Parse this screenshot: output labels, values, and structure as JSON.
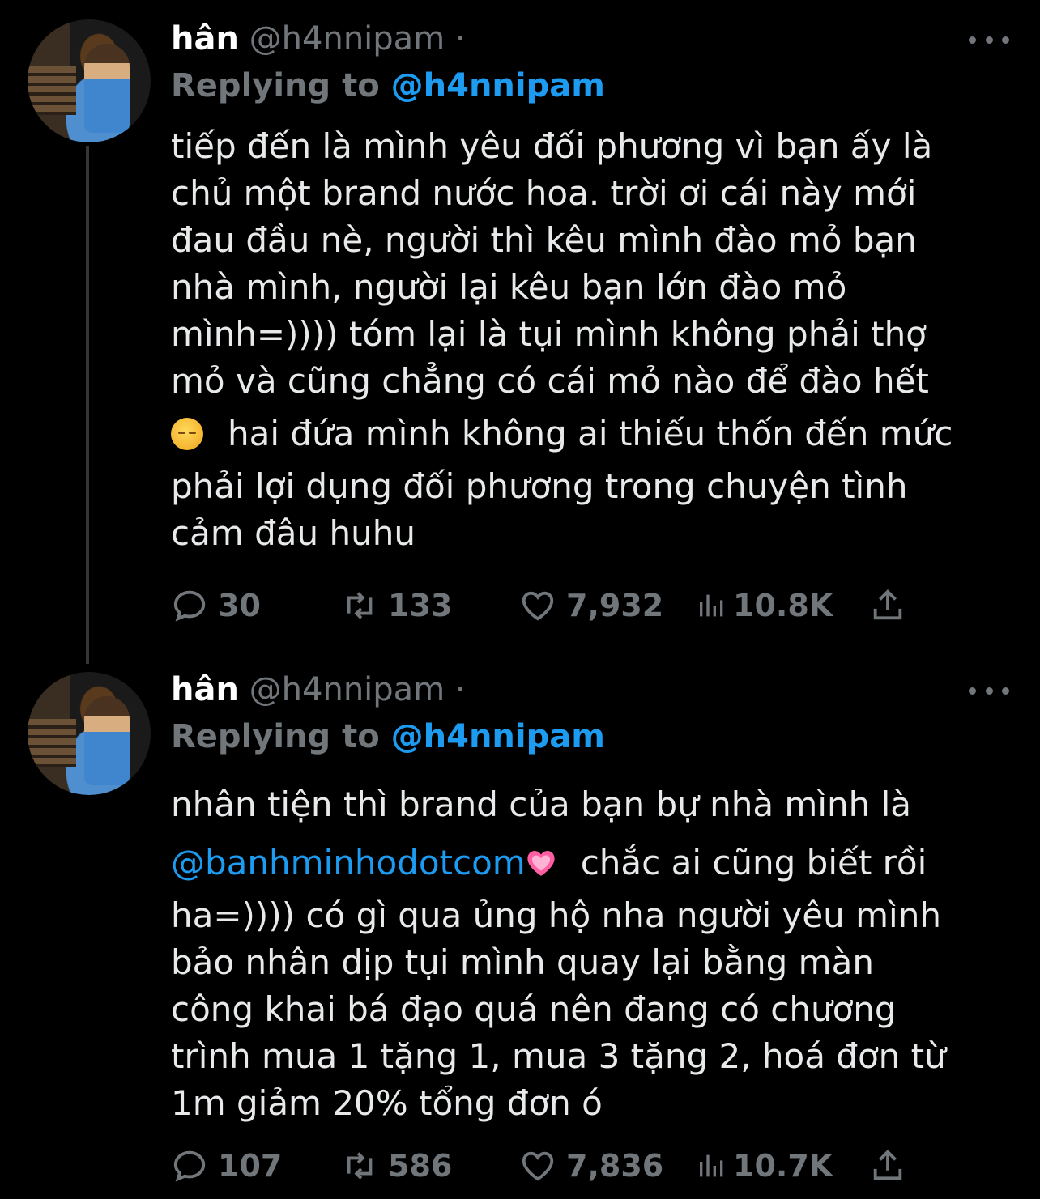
{
  "tweets": [
    {
      "name": "hân",
      "handle": "@h4nnipam",
      "separator": "·",
      "replying_label": "Replying to",
      "replying_to": "@h4nnipam",
      "lines": [
        "tiếp đến là mình yêu đối phương vì bạn ấy là",
        "chủ một brand nước hoa. trời ơi cái này mới",
        "đau đầu nè, người thì kêu mình đào mỏ bạn",
        "nhà mình, người lại kêu bạn lớn đào mỏ",
        "mình=)))) tóm lại là tụi mình không phải thợ",
        "mỏ và cũng chẳng có cái mỏ nào để đào hết",
        "hai đứa mình không ai thiếu thốn đến mức",
        "phải lợi dụng đối phương trong chuyện tình",
        "cảm đâu huhu"
      ],
      "emoji_icon": "pensive-face-emoji",
      "replies": "30",
      "retweets": "133",
      "likes": "7,932",
      "views": "10.8K"
    },
    {
      "name": "hân",
      "handle": "@h4nnipam",
      "separator": "·",
      "replying_label": "Replying to",
      "replying_to": "@h4nnipam",
      "lines": [
        "nhân tiện thì brand của bạn bự nhà mình là",
        "@banhminhodotcom",
        "chắc ai cũng biết rồi",
        "ha=)))) có gì qua ủng hộ nha người yêu mình",
        "bảo nhân dịp tụi mình quay lại bằng màn",
        "công khai bá đạo quá nên đang có chương",
        "trình mua 1 tặng 1, mua 3 tặng 2, hoá đơn từ",
        "1m giảm 20% tổng đơn ó"
      ],
      "emoji_icon": "growing-heart-emoji",
      "replies": "107",
      "retweets": "586",
      "likes": "7,836",
      "views": "10.7K"
    }
  ],
  "colors": {
    "background": "#000000",
    "text": "#e7e9ea",
    "muted": "#71767b",
    "link": "#1d9bf0"
  }
}
